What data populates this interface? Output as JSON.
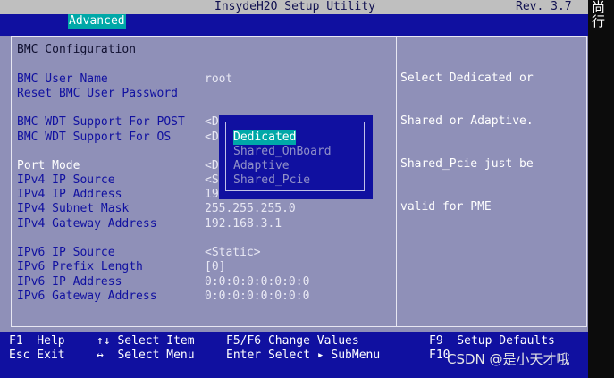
{
  "header": {
    "title": "InsydeH2O Setup Utility",
    "revision": "Rev. 3.7",
    "active_tab": "Advanced"
  },
  "main": {
    "section_title": "BMC Configuration",
    "rows": [
      {
        "label": "BMC User Name",
        "value": "root"
      },
      {
        "label": "Reset BMC User Password",
        "value": ""
      },
      {
        "label": "BMC WDT Support For POST",
        "value": "<D"
      },
      {
        "label": "BMC WDT Support For OS",
        "value": "<D"
      },
      {
        "label": "Port Mode",
        "value": "<D"
      },
      {
        "label": "IPv4 IP Source",
        "value": "<S"
      },
      {
        "label": "IPv4 IP Address",
        "value": "19"
      },
      {
        "label": "IPv4 Subnet Mask",
        "value": "255.255.255.0"
      },
      {
        "label": "IPv4 Gateway Address",
        "value": "192.168.3.1"
      },
      {
        "label": "IPv6 IP Source",
        "value": "<Static>"
      },
      {
        "label": "IPv6 Prefix Length",
        "value": "[0]"
      },
      {
        "label": "IPv6 IP Address",
        "value": "0:0:0:0:0:0:0:0"
      },
      {
        "label": "IPv6 Gateway Address",
        "value": "0:0:0:0:0:0:0:0"
      }
    ]
  },
  "help": {
    "lines": [
      "Select Dedicated or",
      "Shared or Adaptive.",
      "Shared_Pcie just be",
      "valid for PME"
    ]
  },
  "popup": {
    "options": [
      "Dedicated",
      "Shared_OnBoard",
      "Adaptive",
      "Shared_Pcie"
    ],
    "selected": "Dedicated"
  },
  "footer": {
    "keys": [
      "F1  Help",
      "↑↓ Select Item",
      "F5/F6 Change Values",
      "F9  Setup Defaults",
      "Esc Exit",
      "↔  Select Menu",
      "Enter Select ▸ SubMenu",
      "F10"
    ]
  },
  "overlay": {
    "side_text": "尚行",
    "watermark": "CSDN @是小天才哦"
  }
}
